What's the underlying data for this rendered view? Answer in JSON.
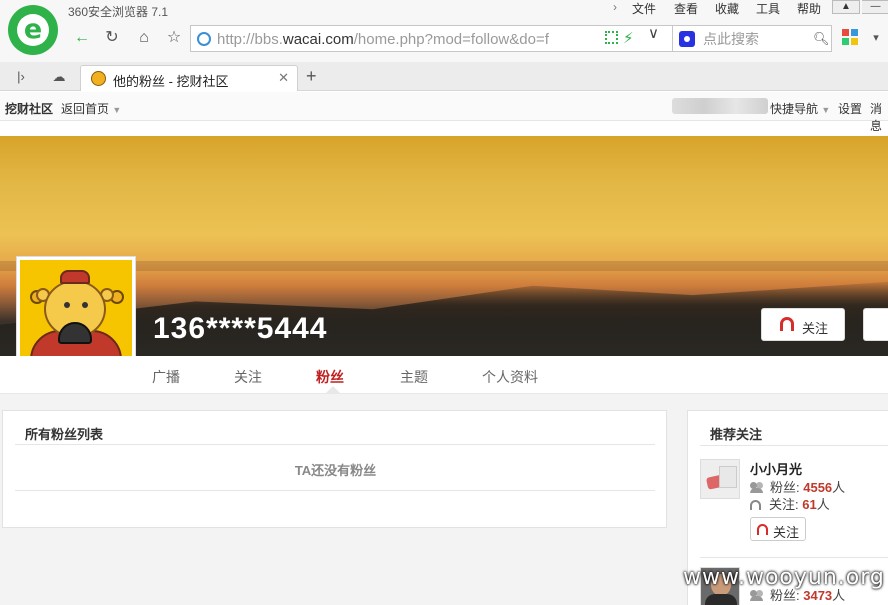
{
  "browser": {
    "app_title": "360安全浏览器 7.1",
    "menus": [
      "文件",
      "查看",
      "收藏",
      "工具",
      "帮助"
    ],
    "url_prefix": "http://bbs.",
    "url_domain": "wacai.com",
    "url_path": "/home.php?mod=follow&do=f",
    "search_placeholder": "点此搜索",
    "tab_title": "他的粉丝 - 挖财社区",
    "accent": "#2fb24a"
  },
  "site": {
    "brand": "挖财社区",
    "home_link": "返回首页",
    "quick_nav": "快捷导航",
    "settings": "设置",
    "messages": "消息"
  },
  "profile": {
    "username": "136****5444",
    "follow_button": "关注",
    "tabs": [
      "广播",
      "关注",
      "粉丝",
      "主题",
      "个人资料"
    ],
    "active_tab": "粉丝"
  },
  "fans_panel": {
    "title": "所有粉丝列表",
    "empty_message": "TA还没有粉丝"
  },
  "recommend": {
    "title": "推荐关注",
    "fans_label": "粉丝: ",
    "follow_label": "关注: ",
    "unit": "人",
    "follow_button": "关注",
    "users": [
      {
        "name": "小小月光",
        "fans": "4556",
        "follows": "61"
      },
      {
        "name": "",
        "fans": "3473"
      }
    ]
  },
  "watermark": "www.wooyun.org",
  "colors": {
    "active_tab": "#c02020",
    "number": "#c0392b"
  }
}
